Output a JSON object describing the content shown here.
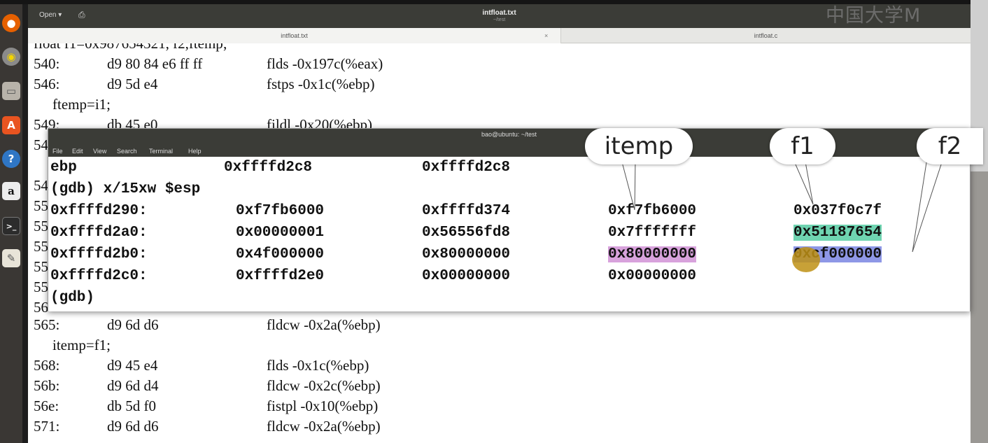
{
  "gedit": {
    "open_label": "Open ▾",
    "title": "intfloat.txt",
    "subtitle": "~/test",
    "tabs": [
      {
        "label": "intfloat.txt"
      },
      {
        "label": "intfloat.c"
      }
    ],
    "tab_close": "×"
  },
  "watermark": "中国大学M",
  "code_lines": [
    {
      "addr": "float  f1=0x987654321, f2,ftemp;",
      "bytes": "",
      "instr": ""
    },
    {
      "addr": "540:",
      "bytes": "d9 80 84 e6 ff ff",
      "instr": "flds   -0x197c(%eax)"
    },
    {
      "addr": "546:",
      "bytes": "d9 5d e4",
      "instr": "fstps  -0x1c(%ebp)"
    },
    {
      "src": "ftemp=i1;"
    },
    {
      "addr": "549:",
      "bytes": "db 45 e0",
      "instr": "fildl  -0x20(%ebp)"
    },
    {
      "addr": "54",
      "bytes": "",
      "instr": ""
    },
    {
      "addr": "",
      "bytes": "",
      "instr": ""
    },
    {
      "addr": "54",
      "bytes": "",
      "instr": ""
    },
    {
      "addr": "55",
      "bytes": "",
      "instr": ""
    },
    {
      "addr": "55",
      "bytes": "",
      "instr": ""
    },
    {
      "addr": "55",
      "bytes": "",
      "instr": ""
    },
    {
      "addr": "55",
      "bytes": "",
      "instr": ""
    },
    {
      "addr": "55",
      "bytes": "",
      "instr": ""
    },
    {
      "addr": "56",
      "bytes": "",
      "instr": ""
    },
    {
      "addr": "565:",
      "bytes": "d9 6d d6",
      "instr": "fldcw  -0x2a(%ebp)"
    },
    {
      "src": "itemp=f1;"
    },
    {
      "addr": "568:",
      "bytes": "d9 45 e4",
      "instr": "flds   -0x1c(%ebp)"
    },
    {
      "addr": "56b:",
      "bytes": "d9 6d d4",
      "instr": "fldcw  -0x2c(%ebp)"
    },
    {
      "addr": "56e:",
      "bytes": "db 5d f0",
      "instr": "fistpl -0x10(%ebp)"
    },
    {
      "addr": "571:",
      "bytes": "d9 6d d6",
      "instr": "fldcw  -0x2a(%ebp)"
    }
  ],
  "terminal": {
    "title": "bao@ubuntu: ~/test",
    "menu": [
      "File",
      "Edit",
      "View",
      "Search",
      "Terminal",
      "Help"
    ],
    "ebp_line": {
      "name": "ebp",
      "v1": "0xffffd2c8",
      "v2": "0xffffd2c8"
    },
    "command": "(gdb) x/15xw $esp",
    "rows": [
      {
        "addr": "0xffffd290:",
        "c1": "0xf7fb6000",
        "c2": "0xffffd374",
        "c3": "0xf7fb6000",
        "c4": "0x037f0c7f"
      },
      {
        "addr": "0xffffd2a0:",
        "c1": "0x00000001",
        "c2": "0x56556fd8",
        "c3": "0x7fffffff",
        "c4": "0x51187654"
      },
      {
        "addr": "0xffffd2b0:",
        "c1": "0x4f000000",
        "c2": "0x80000000",
        "c3": "0x80000000",
        "c4": "0xcf000000"
      },
      {
        "addr": "0xffffd2c0:",
        "c1": "0xffffd2e0",
        "c2": "0x00000000",
        "c3": "0x00000000",
        "c4": ""
      }
    ],
    "prompt": "(gdb)"
  },
  "callouts": [
    {
      "label": "itemp"
    },
    {
      "label": "f1"
    },
    {
      "label": "f2"
    }
  ],
  "colors": {
    "itemp_highlight": "#d8a2dc",
    "f1_highlight": "#6fd4b1",
    "f2_highlight": "#8e97e6"
  },
  "launcher_icons": [
    "firefox-icon",
    "disc-icon",
    "files-icon",
    "software-center-icon",
    "help-icon",
    "amazon-icon",
    "terminal-icon",
    "text-editor-icon"
  ]
}
